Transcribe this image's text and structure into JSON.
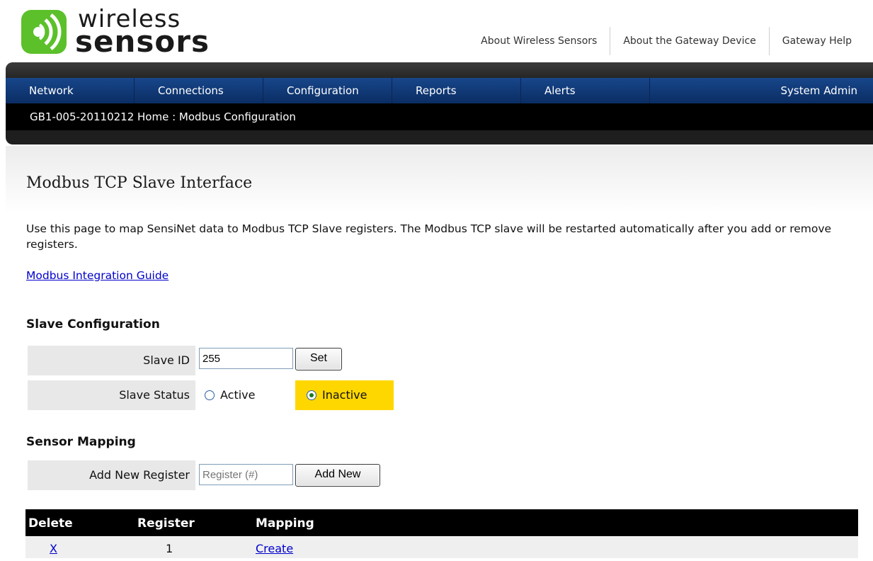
{
  "brand": {
    "word1": "wireless",
    "word2": "sensors",
    "accent": "#5cc02a"
  },
  "top_links": [
    "About Wireless Sensors",
    "About the Gateway Device",
    "Gateway Help"
  ],
  "nav": {
    "items": [
      "Network",
      "Connections",
      "Configuration",
      "Reports",
      "Alerts",
      "System Admin"
    ],
    "breadcrumb": "GB1-005-20110212 Home : Modbus Configuration",
    "color": "#0b2d63"
  },
  "page": {
    "title": "Modbus TCP Slave Interface",
    "intro": "Use this page to map SensiNet data to Modbus TCP Slave registers. The Modbus TCP slave will be restarted automatically after you add or remove registers.",
    "guide_link": "Modbus Integration Guide"
  },
  "slave_config": {
    "heading": "Slave Configuration",
    "slave_id_label": "Slave ID",
    "slave_id_value": "255",
    "set_button": "Set",
    "status_label": "Slave Status",
    "active_label": "Active",
    "inactive_label": "Inactive",
    "selected": "Inactive",
    "highlight_color": "#ffd700"
  },
  "sensor_mapping": {
    "heading": "Sensor Mapping",
    "add_label": "Add New Register",
    "register_placeholder": "Register (#)",
    "add_button": "Add New"
  },
  "table": {
    "headers": {
      "delete": "Delete",
      "register": "Register",
      "mapping": "Mapping"
    },
    "rows": [
      {
        "delete": "X",
        "register": "1",
        "mapping": "Create"
      }
    ]
  }
}
